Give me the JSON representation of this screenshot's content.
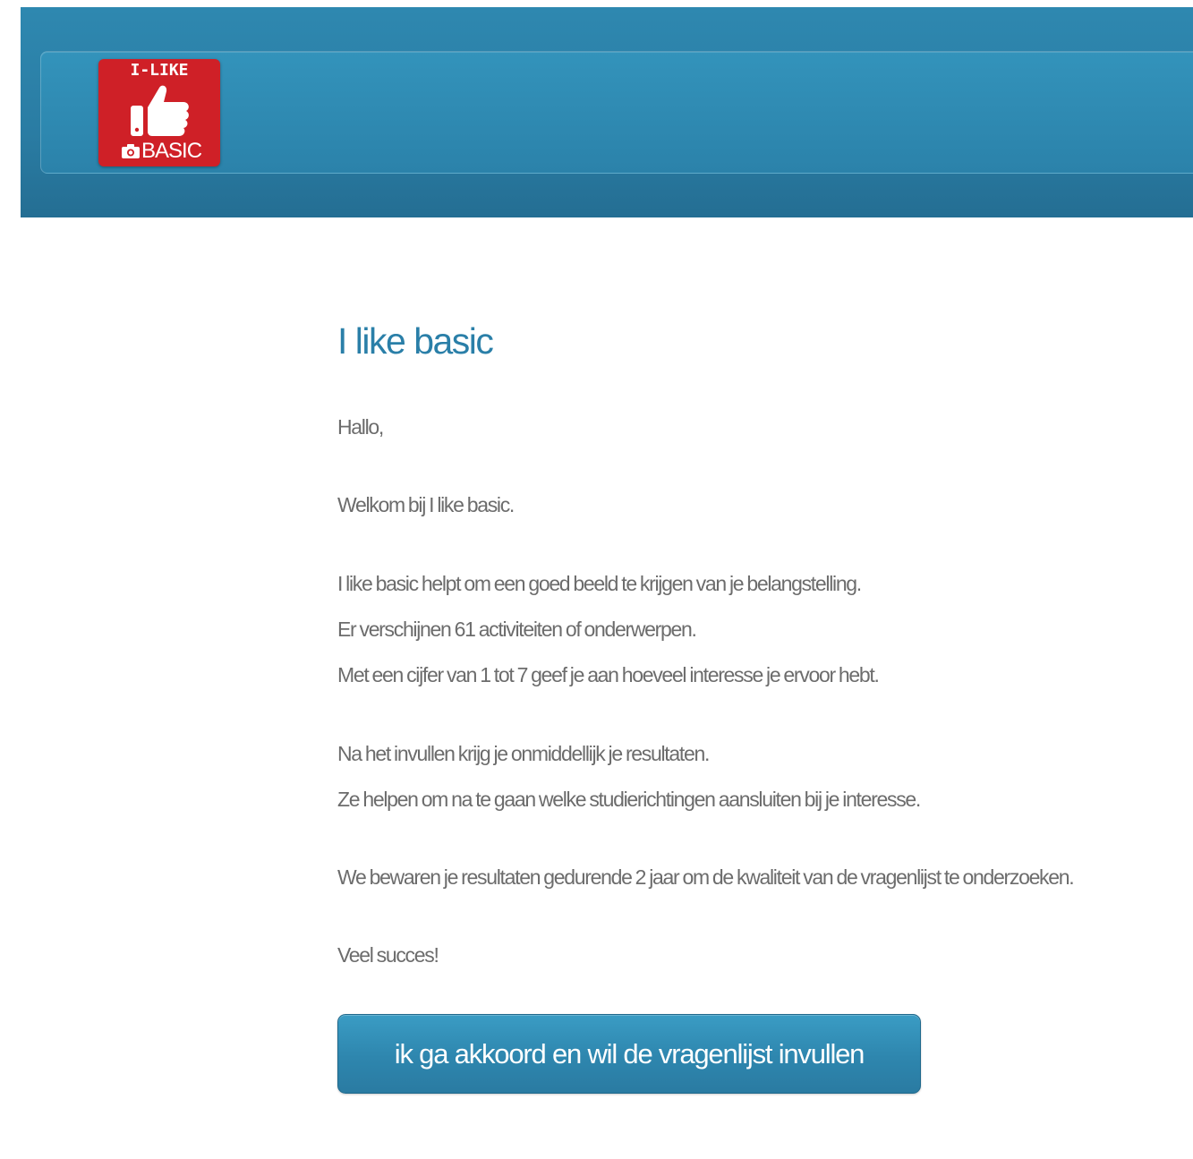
{
  "header": {
    "logo": {
      "top_text": "I-LIKE",
      "bottom_text": "BASIC",
      "color": "#cf2027"
    }
  },
  "main": {
    "title": "I like basic",
    "greeting": "Hallo,",
    "welcome": "Welkom bij I like basic.",
    "paragraph1": [
      "I like basic helpt om een goed beeld te krijgen van je belangstelling.",
      "Er verschijnen 61 activiteiten of onderwerpen.",
      "Met een cijfer van 1 tot 7 geef je aan hoeveel interesse je ervoor hebt."
    ],
    "paragraph2": [
      "Na het invullen krijg je onmiddellijk je resultaten.",
      "Ze helpen om na te gaan welke studierichtingen aansluiten bij je interesse."
    ],
    "retention": "We bewaren je resultaten gedurende 2 jaar om de kwaliteit van de vragenlijst te onderzoeken.",
    "closing": "Veel succes!",
    "cta_label": "ik ga akkoord en wil de vragenlijst invullen"
  },
  "colors": {
    "header_blue": "#2a7ca3",
    "title_blue": "#2a7fa8",
    "body_text": "#6c6c6c",
    "button_blue": "#2e86ae"
  }
}
